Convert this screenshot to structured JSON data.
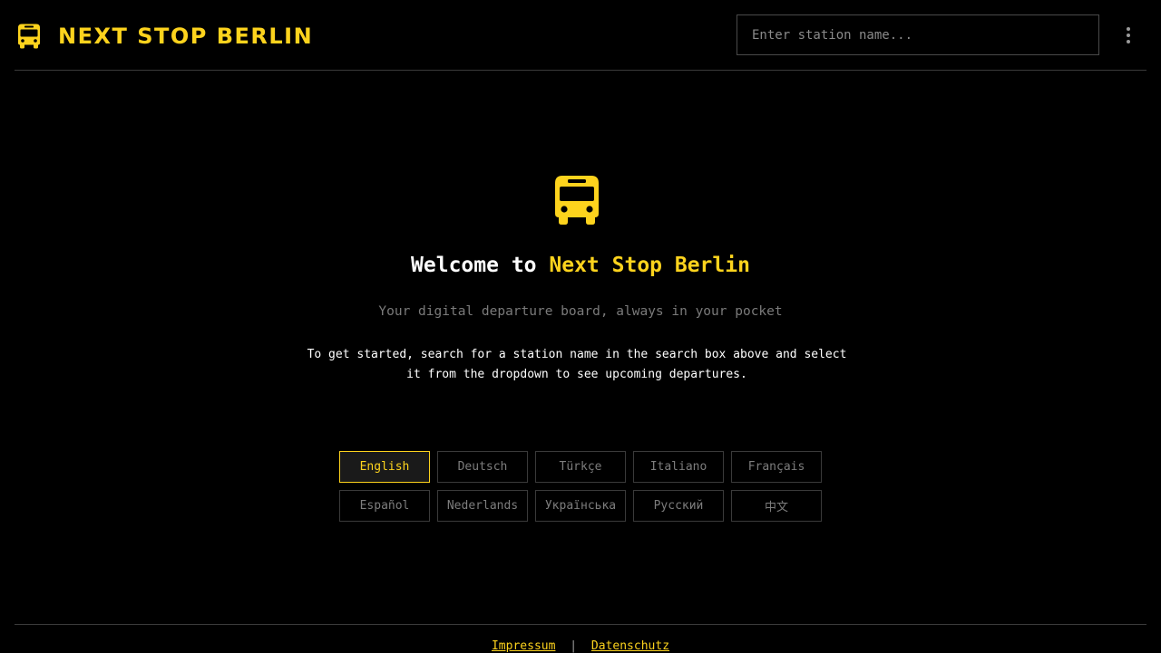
{
  "header": {
    "logo_icon": "bus-icon",
    "title": "NEXT STOP BERLIN",
    "search_placeholder": "Enter station name...",
    "menu_icon": "more-vertical-icon"
  },
  "welcome": {
    "icon": "bus-icon",
    "heading_prefix": "Welcome to",
    "heading_accent": "Next Stop Berlin",
    "tagline": "Your digital departure board, always in your pocket",
    "instructions": "To get started, search for a station name in the search box above and select it from the dropdown to see upcoming departures."
  },
  "languages": {
    "selected": "English",
    "options": [
      "English",
      "Deutsch",
      "Türkçe",
      "Italiano",
      "Français",
      "Español",
      "Nederlands",
      "Українська",
      "Русский",
      "中文"
    ]
  },
  "footer": {
    "impressum": "Impressum",
    "separator": "|",
    "datenschutz": "Datenschutz"
  },
  "colors": {
    "accent": "#fdd31d",
    "background": "#000000",
    "border": "#3a3a3a"
  }
}
